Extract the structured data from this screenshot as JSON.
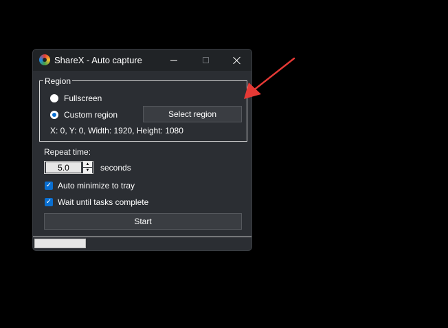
{
  "window": {
    "title": "ShareX - Auto capture"
  },
  "region": {
    "group_label": "Region",
    "fullscreen_label": "Fullscreen",
    "custom_region_label": "Custom region",
    "select_region_button": "Select region",
    "selected_option": "Custom region",
    "coords_text": "X: 0, Y: 0, Width: 1920, Height: 1080"
  },
  "repeat": {
    "label": "Repeat time:",
    "value": "5.0",
    "unit": "seconds"
  },
  "options": {
    "auto_minimize_label": "Auto minimize to tray",
    "auto_minimize_checked": true,
    "wait_tasks_label": "Wait until tasks complete",
    "wait_tasks_checked": true
  },
  "start_button": "Start",
  "progress": {
    "value": 0
  },
  "colors": {
    "accent": "#0a6fd1",
    "annotation_arrow": "#e53935",
    "window_bg": "#2b2e33",
    "titlebar_bg": "#202326"
  },
  "icons": {
    "app": "sharex-logo-icon",
    "minimize": "minimize-icon",
    "maximize": "maximize-icon",
    "close": "close-icon",
    "arrow": "red-arrow-annotation"
  }
}
